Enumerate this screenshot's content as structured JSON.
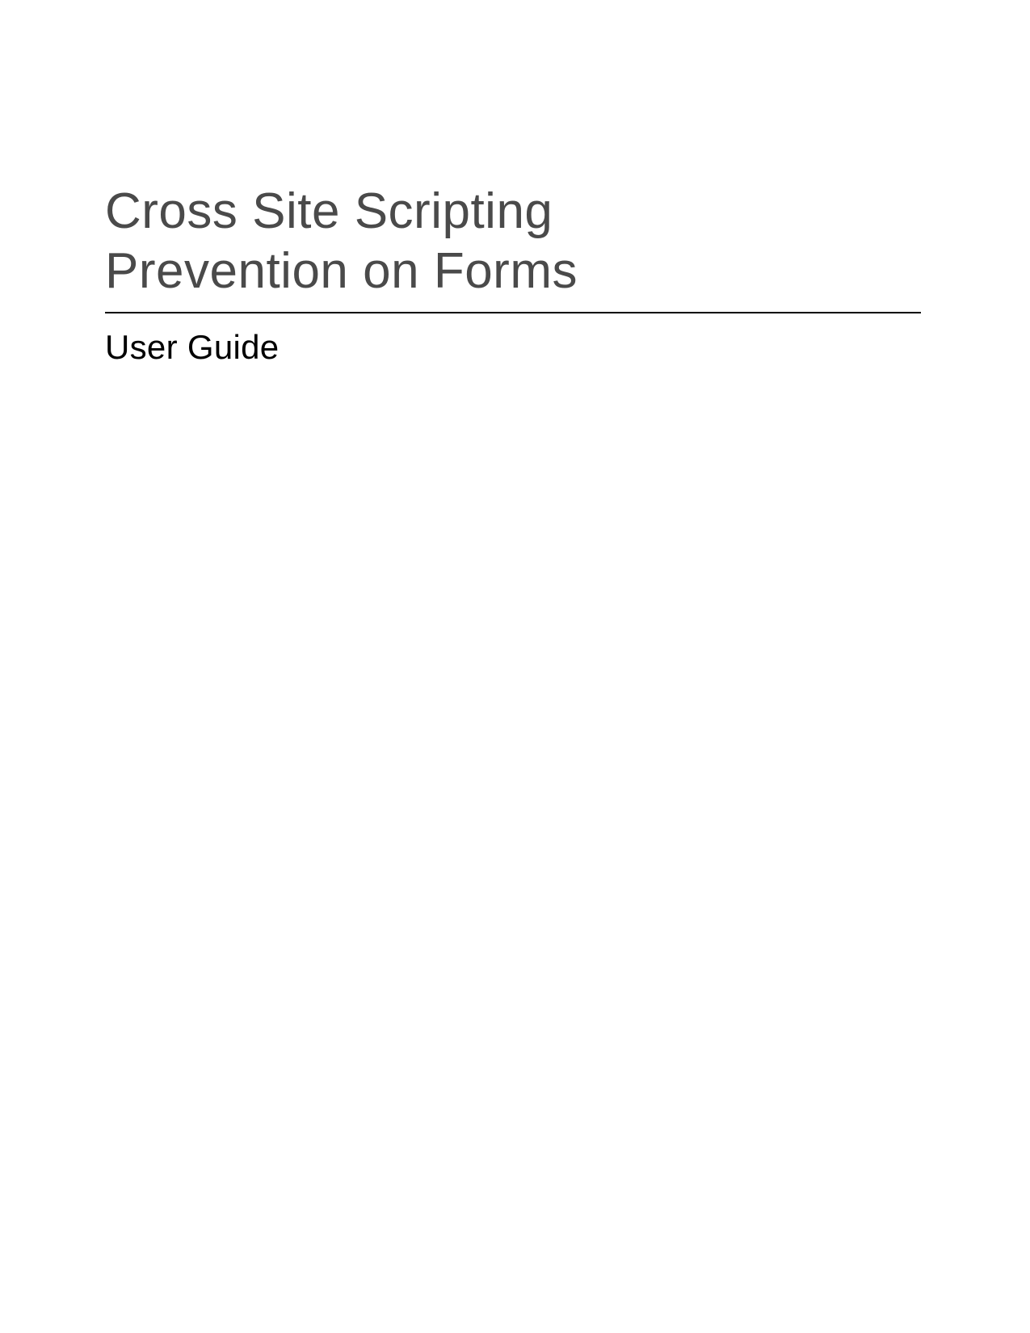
{
  "document": {
    "title_line1": "Cross Site Scripting",
    "title_line2": "Prevention on Forms",
    "subtitle": "User Guide"
  }
}
